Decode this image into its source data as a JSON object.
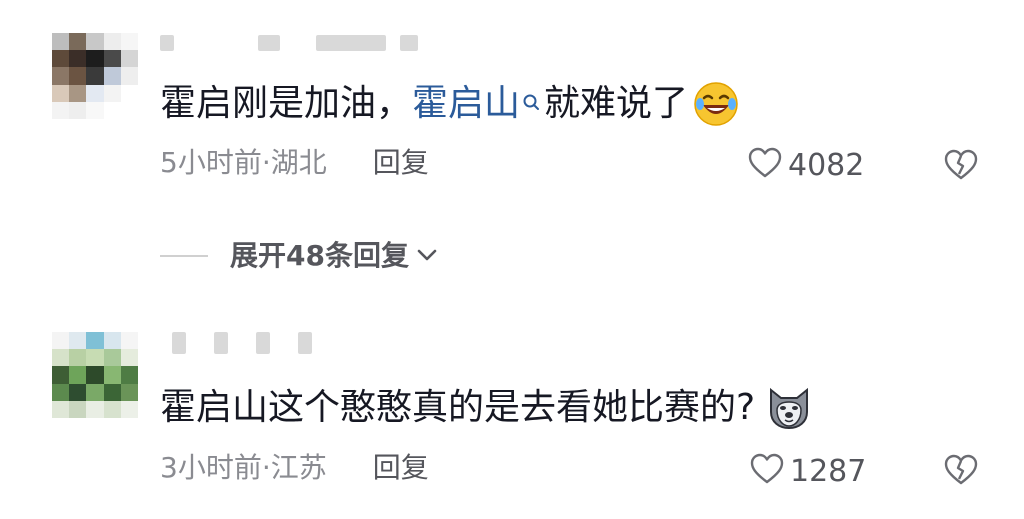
{
  "comments": [
    {
      "text_before": "霍启刚是加油，",
      "mention": "霍启山",
      "text_after": "就难说了",
      "emoji": "laughing-crying-emoji",
      "time": "5小时前",
      "location": "湖北",
      "reply_label": "回复",
      "likes": "4082"
    },
    {
      "text": "霍启山这个憨憨真的是去看她比赛的?",
      "emoji": "doge-emoji",
      "time": "3小时前",
      "location": "江苏",
      "reply_label": "回复",
      "likes": "1287"
    }
  ],
  "expand_replies": "展开48条回复",
  "separator": " · ",
  "colors": {
    "mention": "#2b5b9a",
    "meta": "#8a8b91",
    "text": "#161823"
  }
}
